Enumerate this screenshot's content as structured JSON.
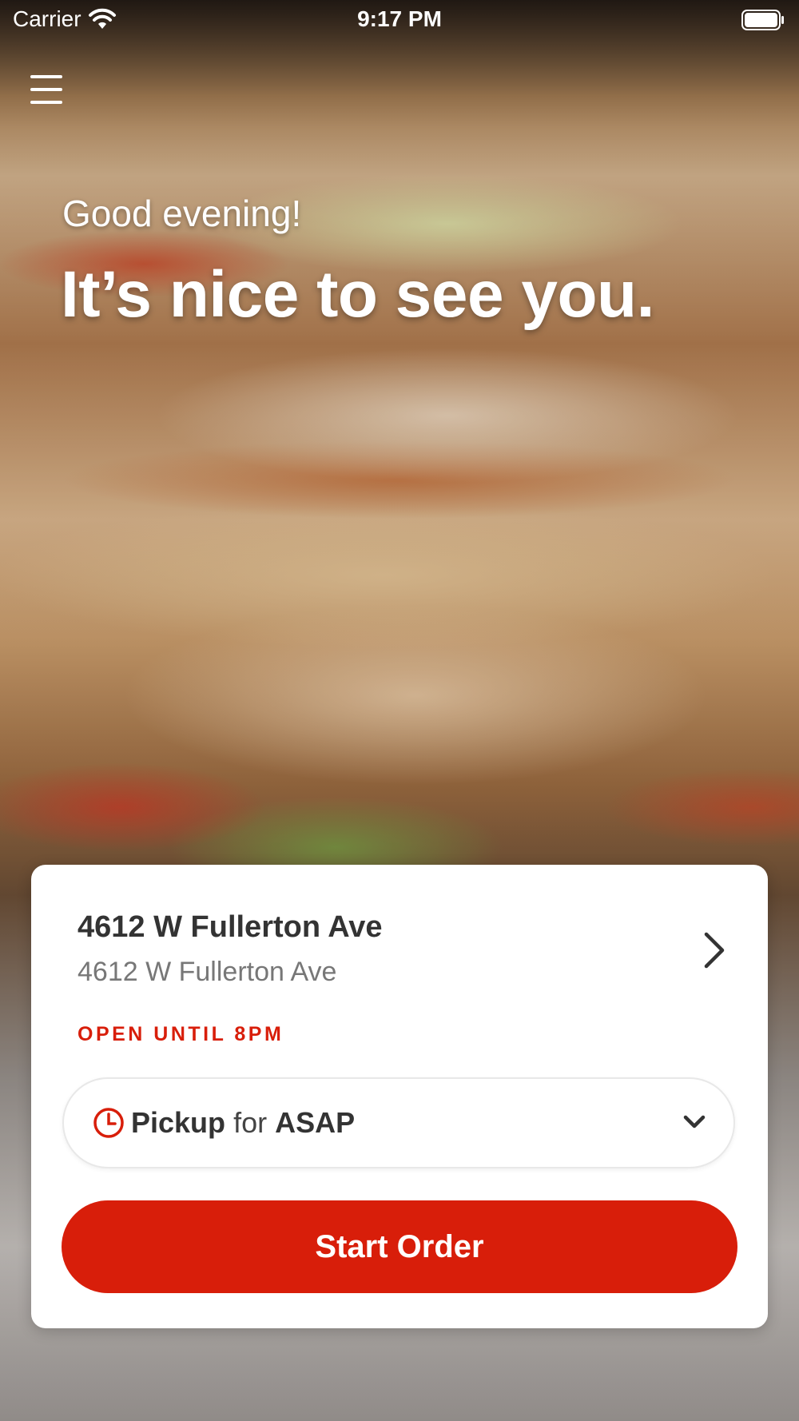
{
  "status_bar": {
    "carrier": "Carrier",
    "time": "9:17 PM",
    "icons": [
      "wifi-icon",
      "battery-icon"
    ]
  },
  "header": {
    "menu_icon": "hamburger-menu-icon"
  },
  "hero": {
    "greeting": "Good evening!",
    "headline": "It’s nice to see you."
  },
  "location_card": {
    "name": "4612 W Fullerton Ave",
    "address": "4612 W Fullerton Ave",
    "hours": "OPEN UNTIL 8PM",
    "order_mode": {
      "mode": "Pickup",
      "connector": "for",
      "time": "ASAP"
    },
    "start_order_label": "Start Order"
  },
  "colors": {
    "accent": "#d81e0a",
    "card_background": "#ffffff",
    "title_text": "#333333",
    "secondary_text": "#777777"
  }
}
